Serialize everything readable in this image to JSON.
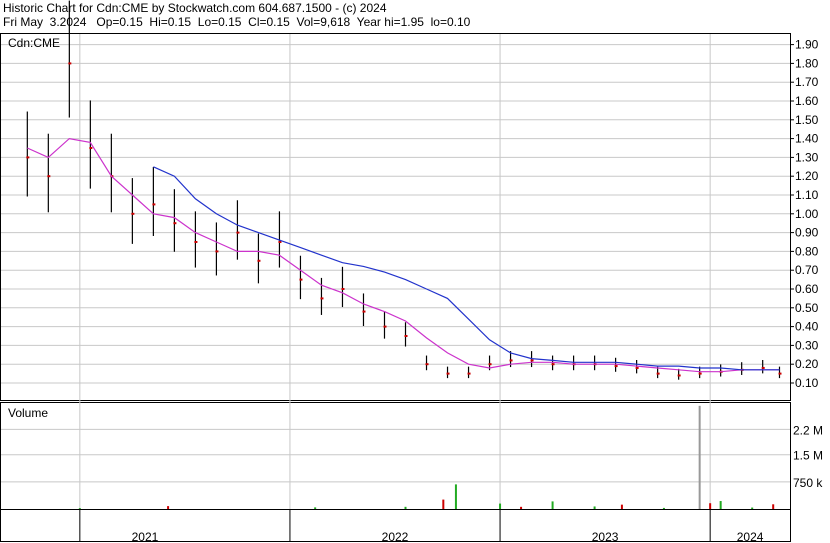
{
  "header": {
    "line1": "Historic Chart for Cdn:CME by Stockwatch.com 604.687.1500 - (c) 2024",
    "line2": "Fri May  3.2024   Op=0.15  Hi=0.15  Lo=0.15  Cl=0.15  Vol=9,618  Year hi=1.95  lo=0.10"
  },
  "colors": {
    "background": "#ffffff",
    "grid": "#c8c8c8",
    "price_bar": "#000000",
    "down_marker": "#cc0000",
    "ma_short": "#cc33cc",
    "ma_long": "#2233cc",
    "volume_up": "#22aa22",
    "volume_down": "#cc0000"
  },
  "chart_data": [
    {
      "type": "line",
      "title": "Cdn:CME",
      "price_axis_labels": [
        "1.90",
        "1.80",
        "1.70",
        "1.60",
        "1.50",
        "1.40",
        "1.30",
        "1.20",
        "1.10",
        "1.00",
        "0.90",
        "0.80",
        "0.70",
        "0.60",
        "0.50",
        "0.40",
        "0.30",
        "0.20",
        "0.10"
      ],
      "ylim": [
        0.05,
        2.0
      ],
      "x_labels": [
        "2021",
        "2022",
        "2023",
        "2024"
      ],
      "x": [
        2020.75,
        2020.85,
        2020.95,
        2021.05,
        2021.15,
        2021.25,
        2021.35,
        2021.45,
        2021.55,
        2021.65,
        2021.75,
        2021.85,
        2021.95,
        2022.05,
        2022.15,
        2022.25,
        2022.35,
        2022.45,
        2022.55,
        2022.65,
        2022.75,
        2022.85,
        2022.95,
        2023.05,
        2023.15,
        2023.25,
        2023.35,
        2023.45,
        2023.55,
        2023.65,
        2023.75,
        2023.85,
        2023.95,
        2024.05,
        2024.15,
        2024.25,
        2024.33
      ],
      "series": [
        {
          "values": [
            1.3,
            1.2,
            1.8,
            1.35,
            1.2,
            1.0,
            1.05,
            0.95,
            0.85,
            0.8,
            0.9,
            0.75,
            0.85,
            0.65,
            0.55,
            0.6,
            0.48,
            0.4,
            0.35,
            0.2,
            0.15,
            0.15,
            0.2,
            0.22,
            0.22,
            0.2,
            0.2,
            0.2,
            0.19,
            0.18,
            0.15,
            0.14,
            0.15,
            0.16,
            0.17,
            0.18,
            0.15
          ]
        },
        {
          "values": [
            1.35,
            1.3,
            1.4,
            1.38,
            1.2,
            1.1,
            1.0,
            0.98,
            0.9,
            0.85,
            0.8,
            0.8,
            0.78,
            0.7,
            0.62,
            0.58,
            0.52,
            0.48,
            0.43,
            0.34,
            0.26,
            0.2,
            0.18,
            0.2,
            0.21,
            0.21,
            0.2,
            0.2,
            0.2,
            0.19,
            0.18,
            0.17,
            0.16,
            0.16,
            0.17,
            0.17,
            0.17
          ]
        },
        {
          "values": [
            null,
            null,
            null,
            null,
            null,
            null,
            1.25,
            1.2,
            1.08,
            1.0,
            0.94,
            0.9,
            0.86,
            0.82,
            0.78,
            0.74,
            0.72,
            0.69,
            0.65,
            0.6,
            0.55,
            0.44,
            0.33,
            0.26,
            0.23,
            0.22,
            0.21,
            0.21,
            0.21,
            0.2,
            0.19,
            0.19,
            0.18,
            0.18,
            0.17,
            0.17,
            0.17
          ]
        }
      ]
    },
    {
      "type": "bar",
      "title": "Volume",
      "volume_axis_labels": [
        "2.2 M",
        "1.5 M",
        "750 k"
      ],
      "ylim": [
        0,
        2900000
      ],
      "x": [
        2021.0,
        2021.42,
        2022.12,
        2022.55,
        2022.73,
        2022.79,
        2023.0,
        2023.1,
        2023.25,
        2023.45,
        2023.58,
        2023.78,
        2023.95,
        2024.0,
        2024.05,
        2024.2,
        2024.3
      ],
      "values": [
        25000,
        80000,
        45000,
        60000,
        260000,
        680000,
        150000,
        60000,
        210000,
        70000,
        120000,
        30000,
        2850000,
        160000,
        220000,
        40000,
        130000
      ]
    }
  ]
}
